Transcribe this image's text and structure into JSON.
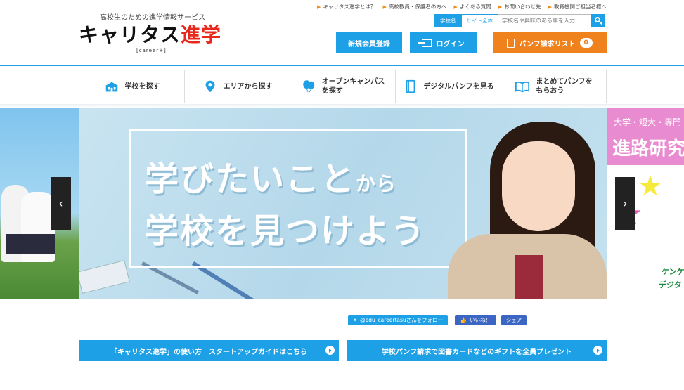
{
  "header": {
    "tagline": "高校生のための進学情報サービス",
    "logo_main": "キャリタス",
    "logo_red": "進学",
    "logo_sub": "[career+]",
    "top_links": [
      "キャリタス進学とは？",
      "高校教員・保護者の方へ",
      "よくある質問",
      "お問い合わせ先",
      "教育機関ご担当者様へ"
    ],
    "search": {
      "tab_school": "学校名",
      "tab_site": "サイト全体",
      "placeholder": "学校名や興味のある事を入力"
    },
    "buttons": {
      "register": "新規会員登録",
      "login": "ログイン",
      "pamphlet": "パンフ請求リスト",
      "pamphlet_count": "0"
    }
  },
  "nav": [
    {
      "label": "学校を探す"
    },
    {
      "label": "エリアから探す"
    },
    {
      "label1": "オープンキャンパス",
      "label2": "を探す"
    },
    {
      "label": "デジタルパンフを見る"
    },
    {
      "label1": "まとめてパンフを",
      "label2": "もらおう"
    }
  ],
  "hero": {
    "line1_big": "学びたいこと",
    "line1_small": "から",
    "line2": "学校を見つけよう",
    "right_line1": "大学・短大・専門",
    "right_line2": "進路研究",
    "right_line3": "ケンケ",
    "right_line4": "デジタ",
    "prev": "‹",
    "next": "›"
  },
  "social": {
    "twitter": "@edu_careertasuさんをフォロー",
    "like": "いいね！",
    "share": "シェア"
  },
  "banners": {
    "guide": "「キャリタス進学」の使い方　スタートアップガイドはこちら",
    "present": "学校パンフ請求で図書カードなどのギフトを全員プレゼント"
  },
  "colors": {
    "primary": "#1ea0e6",
    "orange": "#f0821e",
    "logo_red": "#e8271d",
    "facebook": "#3b66c4"
  }
}
